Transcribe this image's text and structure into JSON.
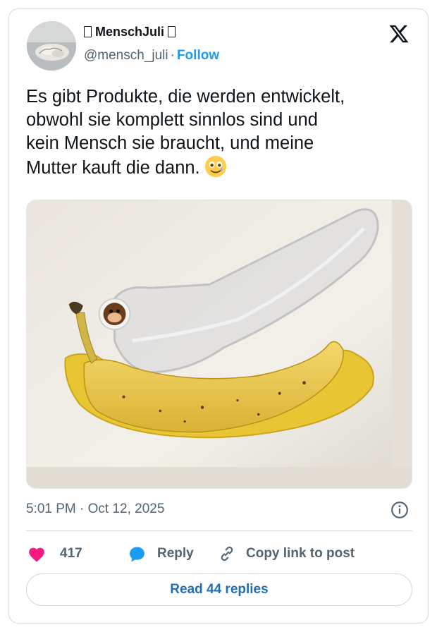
{
  "author": {
    "display_name": "MenschJuli",
    "handle": "@mensch_juli",
    "separator": "·",
    "follow_label": "Follow"
  },
  "tweet": {
    "text": "Es gibt Produkte, die werden entwickelt,\nobwohl sie komplett sinnlos sind und\nkein Mensch sie braucht, und meine\nMutter kauft die dann.",
    "emoji": "smiling-face-with-tear-emoji",
    "timestamp": "5:01 PM · Oct 12, 2025"
  },
  "actions": {
    "like_count": "417",
    "reply_label": "Reply",
    "copy_link_label": "Copy link to post"
  },
  "read_replies_label": "Read 44 replies",
  "icons": {
    "brand": "x-logo-icon",
    "like": "heart-icon",
    "reply": "speech-bubble-icon",
    "copy": "link-icon",
    "info": "info-icon"
  },
  "colors": {
    "link_blue": "#1d9bf0",
    "heart_pink": "#f91880",
    "secondary_text": "#536471",
    "border": "#cfd9de"
  }
}
